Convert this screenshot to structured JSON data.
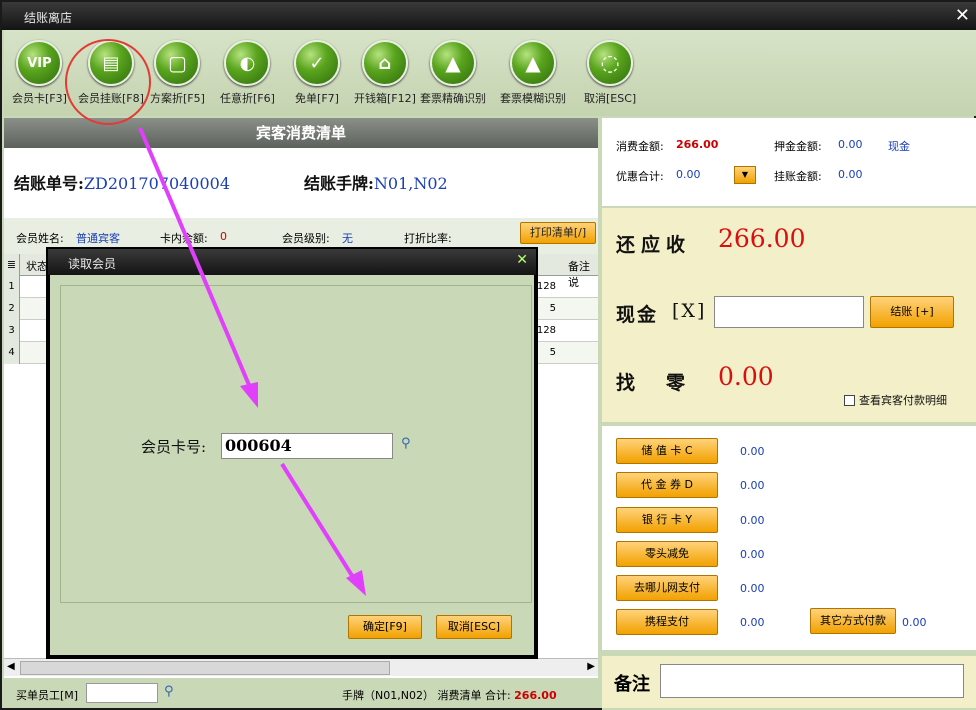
{
  "window": {
    "title": "结账离店"
  },
  "toolbar": [
    {
      "label": "会员卡[F3]",
      "glyph": "VIP"
    },
    {
      "label": "会员挂账[F8]",
      "glyph": "▤"
    },
    {
      "label": "方案折[F5]",
      "glyph": "▢"
    },
    {
      "label": "任意折[F6]",
      "glyph": "◐"
    },
    {
      "label": "免单[F7]",
      "glyph": "✓"
    },
    {
      "label": "开钱箱[F12]",
      "glyph": "⌂"
    },
    {
      "label": "套票精确识别",
      "glyph": "▲"
    },
    {
      "label": "套票模糊识别",
      "glyph": "▲"
    },
    {
      "label": "取消[ESC]",
      "glyph": "◌"
    }
  ],
  "bill": {
    "header": "宾客消费清单",
    "bill_no_label": "结账单号:",
    "bill_no": "ZD201707040004",
    "plate_label": "结账手牌:",
    "plate": "N01,N02",
    "member_name_label": "会员姓名:",
    "member_name": "普通宾客",
    "card_balance_label": "卡内余额:",
    "card_balance": "0",
    "member_level_label": "会员级别:",
    "member_level": "无",
    "discount_label": "打折比率:",
    "print_btn": "打印清单[/]",
    "col_state": "状态",
    "col_note": "备注说",
    "rows": [
      {
        "n": "1",
        "v": "128"
      },
      {
        "n": "2",
        "v": "5"
      },
      {
        "n": "3",
        "v": "128"
      },
      {
        "n": "4",
        "v": "5"
      }
    ]
  },
  "bottombar": {
    "staff_label": "买单员工[M]",
    "summary_pre": "手牌（N01,N02） 消费清单 合计:",
    "total": "266.00"
  },
  "summary": {
    "consume_label": "消费金额:",
    "consume": "266.00",
    "deposit_label": "押金金额:",
    "deposit": "0.00",
    "cash_tag": "现金",
    "discount_label": "优惠合计:",
    "discount": "0.00",
    "credit_label": "挂账金额:",
    "credit": "0.00"
  },
  "payment": {
    "due_label": "还应收",
    "due": "266.00",
    "cash_label": "现金",
    "cash_key": "[X]",
    "settle_btn": "结账 [+]",
    "change_label": "找　零",
    "change": "0.00",
    "detail_chk": "查看宾客付款明细"
  },
  "methods": [
    {
      "label": "储 值 卡 C",
      "value": "0.00"
    },
    {
      "label": "代 金 券 D",
      "value": "0.00"
    },
    {
      "label": "银 行 卡 Y",
      "value": "0.00"
    },
    {
      "label": "零头减免",
      "value": "0.00"
    },
    {
      "label": "去哪儿网支付",
      "value": "0.00"
    },
    {
      "label": "携程支付",
      "value": "0.00"
    }
  ],
  "other_pay": {
    "label": "其它方式付款",
    "value": "0.00"
  },
  "note": {
    "label": "备注"
  },
  "dialog": {
    "title": "读取会员",
    "card_label": "会员卡号:",
    "card_value": "000604",
    "ok_btn": "确定[F9]",
    "cancel_btn": "取消[ESC]"
  },
  "colors": {
    "accent_orange": "#f2a100",
    "amount_red": "#d81010",
    "value_blue": "#1b3fb5",
    "annotation_magenta": "#e040fb",
    "annotation_red": "#e53935"
  }
}
